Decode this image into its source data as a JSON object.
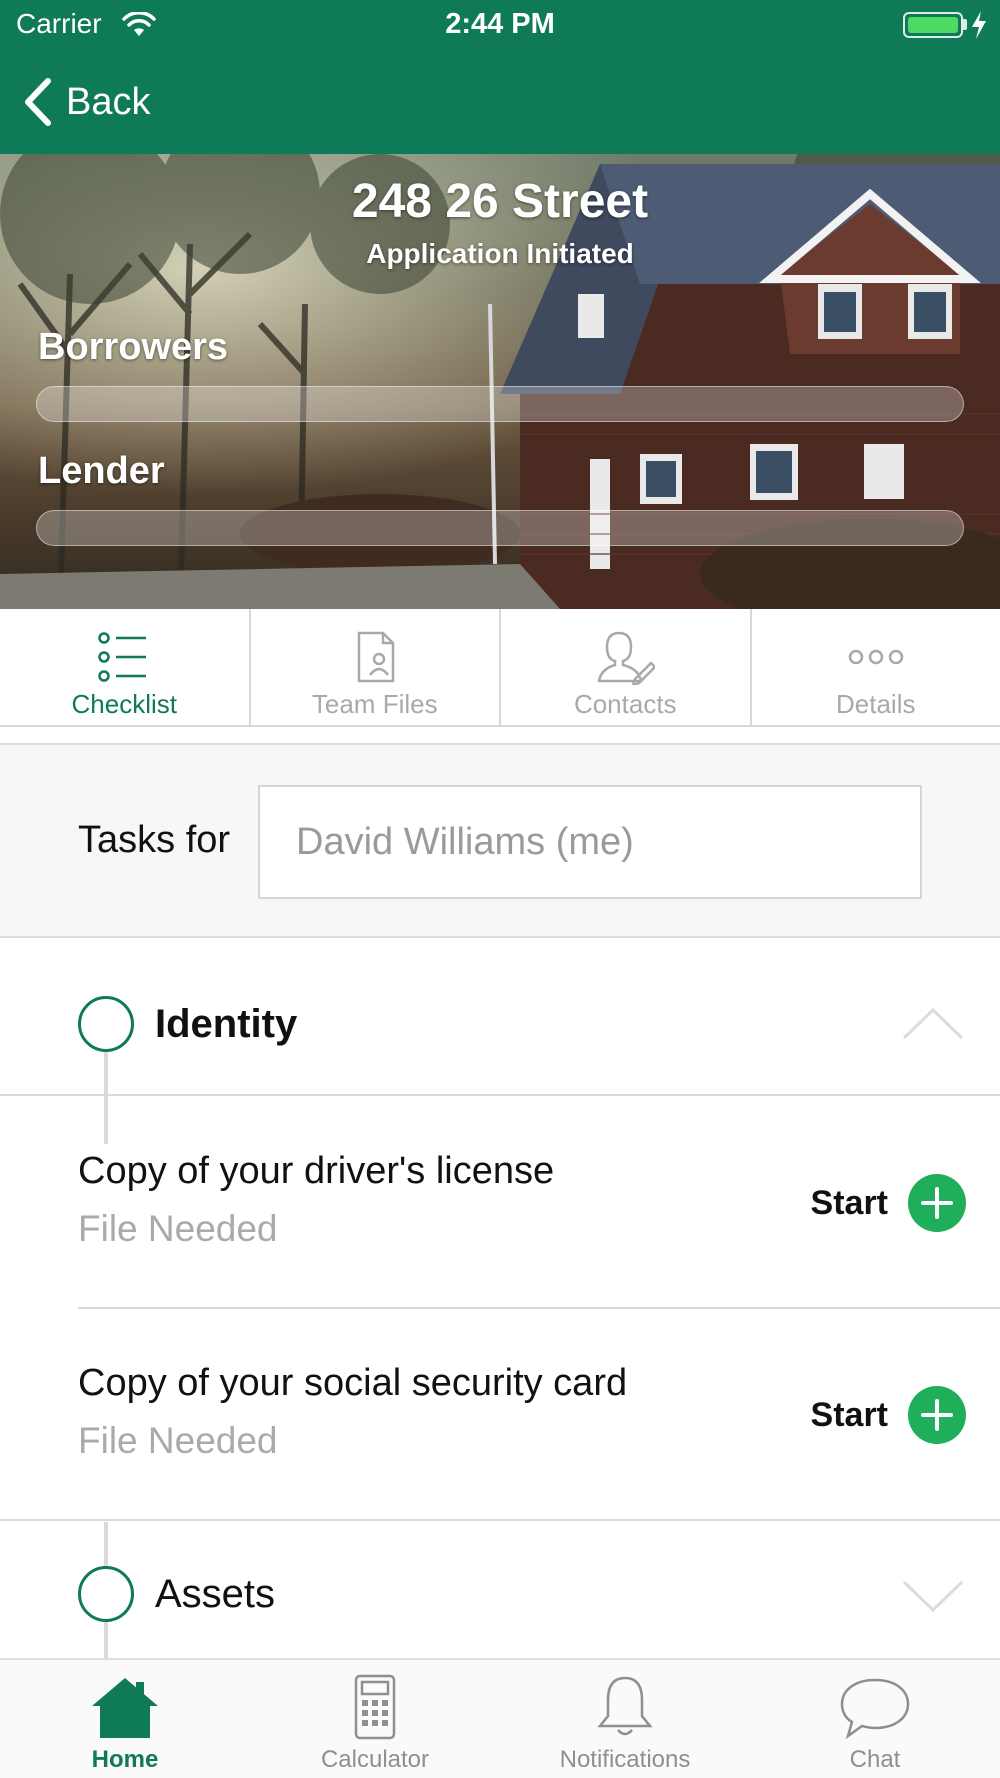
{
  "status_bar": {
    "carrier": "Carrier",
    "time": "2:44 PM"
  },
  "nav": {
    "back_label": "Back"
  },
  "hero": {
    "title": "248 26 Street",
    "subtitle": "Application Initiated",
    "borrowers_label": "Borrowers",
    "lender_label": "Lender"
  },
  "tabs": [
    {
      "label": "Checklist",
      "icon": "checklist-icon",
      "active": true
    },
    {
      "label": "Team Files",
      "icon": "file-person-icon",
      "active": false
    },
    {
      "label": "Contacts",
      "icon": "person-edit-icon",
      "active": false
    },
    {
      "label": "Details",
      "icon": "more-dots-icon",
      "active": false
    }
  ],
  "filter": {
    "label": "Tasks for",
    "value": "David Williams (me)"
  },
  "checklist": {
    "sections": [
      {
        "title": "Identity",
        "expanded": true,
        "tasks": [
          {
            "title": "Copy of your driver's license",
            "status": "File Needed",
            "action": "Start"
          },
          {
            "title": "Copy of your social security card",
            "status": "File Needed",
            "action": "Start"
          }
        ]
      },
      {
        "title": "Assets",
        "expanded": false,
        "tasks": []
      }
    ]
  },
  "bottom_tabs": [
    {
      "label": "Home",
      "icon": "home-icon",
      "active": true
    },
    {
      "label": "Calculator",
      "icon": "calculator-icon",
      "active": false
    },
    {
      "label": "Notifications",
      "icon": "bell-icon",
      "active": false
    },
    {
      "label": "Chat",
      "icon": "chat-bubble-icon",
      "active": false
    }
  ],
  "colors": {
    "brand": "#0f7a57",
    "action": "#1fae5a",
    "inactive": "#a9a9a9"
  }
}
